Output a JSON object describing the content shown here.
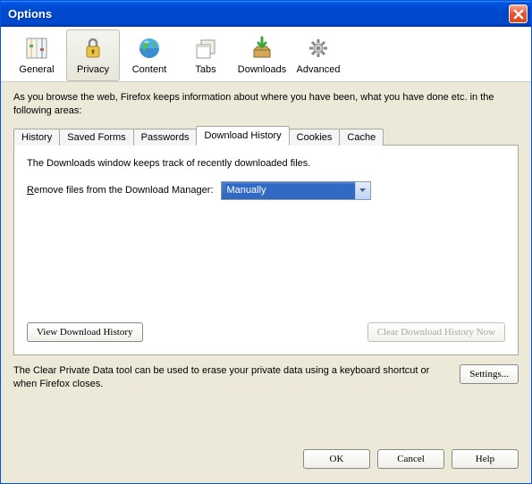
{
  "window": {
    "title": "Options"
  },
  "toolbar": {
    "general": "General",
    "privacy": "Privacy",
    "content": "Content",
    "tabs": "Tabs",
    "downloads": "Downloads",
    "advanced": "Advanced"
  },
  "intro": "As you browse the web, Firefox keeps information about where you have been, what you have done etc. in the following areas:",
  "tabs": {
    "history": "History",
    "saved_forms": "Saved Forms",
    "passwords": "Passwords",
    "download_history": "Download History",
    "cookies": "Cookies",
    "cache": "Cache"
  },
  "panel": {
    "description": "The Downloads window keeps track of recently downloaded files.",
    "remove_label_pre": "R",
    "remove_label_post": "emove files from the Download Manager:",
    "select_value": "Manually",
    "view_btn": "View Download History",
    "clear_btn": "Clear Download History Now"
  },
  "bottom": {
    "note": "The Clear Private Data tool can be used to erase your private data using a keyboard shortcut or when Firefox closes.",
    "settings": "Settings..."
  },
  "dialog": {
    "ok": "OK",
    "cancel": "Cancel",
    "help": "Help"
  }
}
